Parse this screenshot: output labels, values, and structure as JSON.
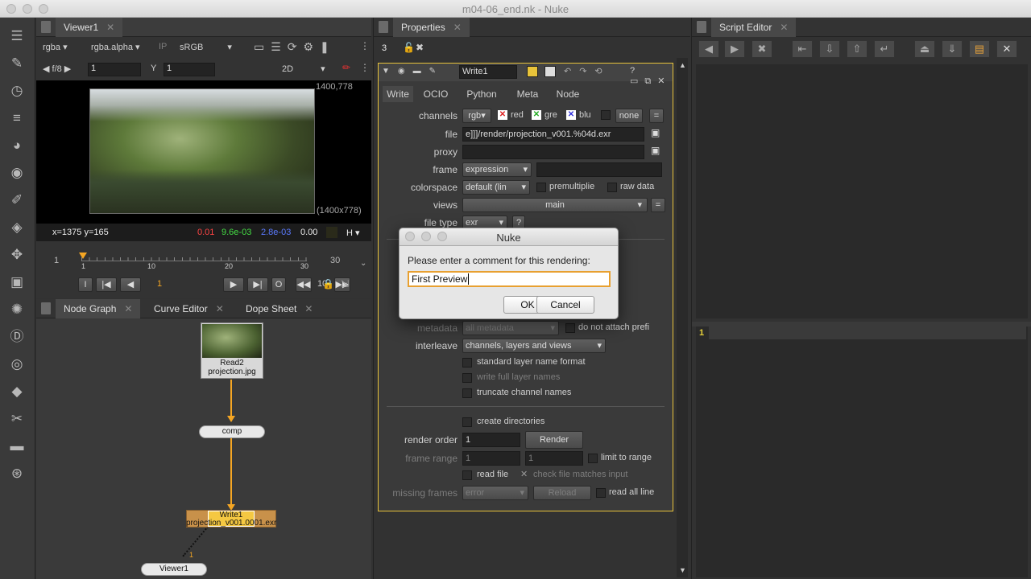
{
  "window": {
    "title": "m04-06_end.nk - Nuke"
  },
  "toolbar": {
    "icons": [
      "viewer-icon",
      "paint-icon",
      "time-icon",
      "channel-icon",
      "color-icon",
      "filter-icon",
      "keyer-icon",
      "merge-icon",
      "transform-icon",
      "3d-icon",
      "particles-icon",
      "deep-icon",
      "views-icon",
      "metadata-icon",
      "toolsets-icon",
      "other-icon",
      "furnace-icon"
    ]
  },
  "viewer": {
    "tab": "Viewer1",
    "channels": "rgba",
    "alpha": "rgba.alpha",
    "ip": "IP",
    "lut": "sRGB",
    "fstop": "f/8",
    "frame_field": "1",
    "y_label": "Y",
    "y_field": "1",
    "mode": "2D",
    "res_top": "1400,778",
    "res_side": "(1400x778)",
    "coords": "x=1375 y=165",
    "r": "0.01",
    "g": "9.6e-03",
    "b": "2.8e-03",
    "a": "0.00",
    "h": "H",
    "range_start": "1",
    "range_end": "30",
    "ticks": [
      "1",
      "10",
      "20",
      "30"
    ],
    "cur_frame": "1",
    "inc": "10",
    "i_btn": "I",
    "o_btn": "O"
  },
  "colors": {
    "accent": "#f5a623",
    "node_write": "#f5c842",
    "red": "#ff4444",
    "green": "#44dd44",
    "blue": "#4a6aff"
  },
  "nodegraph": {
    "tabs": [
      "Node Graph",
      "Curve Editor",
      "Dope Sheet"
    ],
    "nodes": {
      "read": {
        "name": "Read2",
        "file": "projection.jpg"
      },
      "comp": "comp",
      "write": {
        "name": "Write1",
        "file": "projection_v001.0001.exr"
      },
      "viewer": "Viewer1",
      "pipe_num": "1"
    }
  },
  "properties": {
    "tab": "Properties",
    "count": "3",
    "node_name": "Write1",
    "subtabs": [
      "Write",
      "OCIO",
      "Python",
      "Meta",
      "Node"
    ],
    "channels": {
      "label": "channels",
      "value": "rgb",
      "red": "red",
      "green": "gre",
      "blue": "blu",
      "none": "none"
    },
    "file": {
      "label": "file",
      "value": "e]]]/render/projection_v001.%04d.exr"
    },
    "proxy": {
      "label": "proxy"
    },
    "frame": {
      "label": "frame",
      "value": "expression"
    },
    "colorspace": {
      "label": "colorspace",
      "value": "default (lin",
      "premult": "premultiplie",
      "raw": "raw data"
    },
    "views": {
      "label": "views",
      "value": "main"
    },
    "filetype": {
      "label": "file type",
      "value": "exr",
      "help": "?"
    },
    "metadata": {
      "label": "metadata",
      "value": "all metadata",
      "attach": "do not attach prefi"
    },
    "interleave": {
      "label": "interleave",
      "value": "channels, layers and views"
    },
    "std_layer": "standard layer name format",
    "full_layer": "write full layer names",
    "truncate": "truncate channel names",
    "create_dirs": "create directories",
    "render_order": {
      "label": "render order",
      "value": "1",
      "render_btn": "Render"
    },
    "frame_range": {
      "label": "frame range",
      "start": "1",
      "end": "1",
      "limit": "limit to range"
    },
    "read_file": "read file",
    "check_file": "check file matches input",
    "missing": {
      "label": "missing frames",
      "value": "error",
      "reload": "Reload",
      "read_all": "read all line"
    }
  },
  "dialog": {
    "title": "Nuke",
    "prompt": "Please enter a comment for this rendering:",
    "value": "First Preview",
    "ok": "OK",
    "cancel": "Cancel"
  },
  "script_editor": {
    "tab": "Script Editor",
    "line_num": "1"
  }
}
